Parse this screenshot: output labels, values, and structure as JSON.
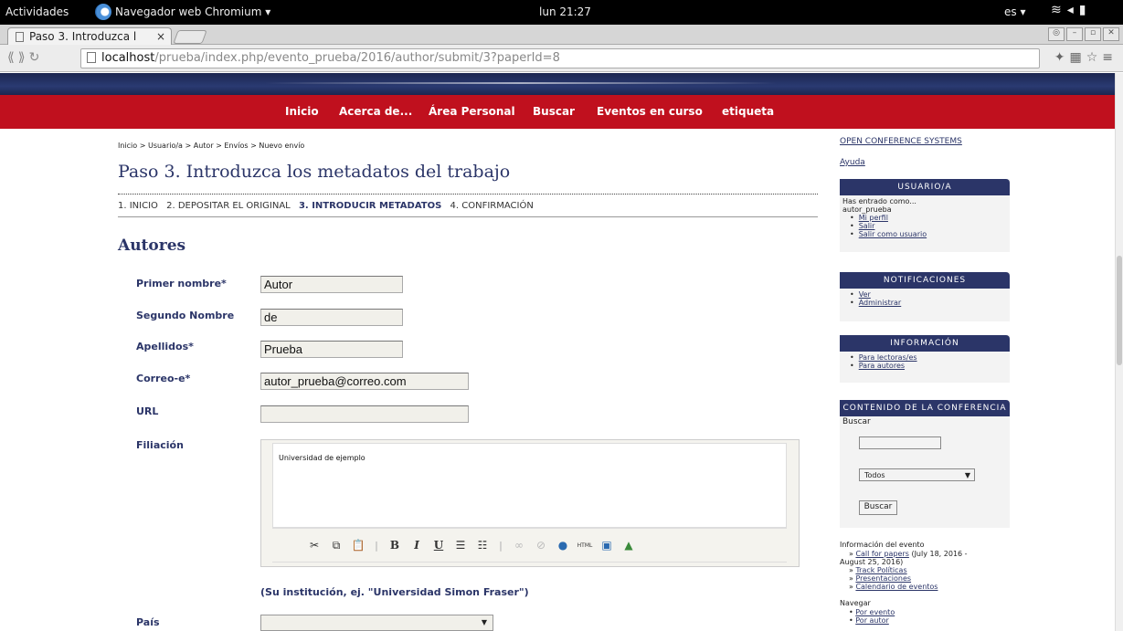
{
  "topbar": {
    "activities": "Actividades",
    "app_name": "Navegador web Chromium ▾",
    "clock": "lun 21:27",
    "lang": "es ▾",
    "sys_icons": "wifi-icon volume-icon battery-icon"
  },
  "tab": {
    "title": "Paso 3. Introduzca l",
    "close": "×"
  },
  "omnibox": {
    "host": "localhost",
    "path": "/prueba/index.php/evento_prueba/2016/author/submit/3?paperId=8"
  },
  "nav": [
    "Inicio",
    "Acerca de...",
    "Área Personal",
    "Buscar",
    "Eventos en curso",
    "etiqueta"
  ],
  "breadcrumb": "Inicio > Usuario/a > Autor > Envíos > Nuevo envío",
  "page_title": "Paso 3. Introduzca los metadatos del trabajo",
  "steps": [
    "1. INICIO",
    "2. DEPOSITAR EL ORIGINAL",
    "3. INTRODUCIR METADATOS",
    "4. CONFIRMACIÓN"
  ],
  "section_title": "Autores",
  "form": {
    "first_name_label": "Primer nombre*",
    "first_name_value": "Autor",
    "middle_name_label": "Segundo Nombre",
    "middle_name_value": "de",
    "last_name_label": "Apellidos*",
    "last_name_value": "Prueba",
    "email_label": "Correo-e*",
    "email_value": "autor_prueba@correo.com",
    "url_label": "URL",
    "url_value": "",
    "affiliation_label": "Filiación",
    "affiliation_value": "Universidad de ejemplo",
    "affiliation_hint": "(Su institución, ej. \"Universidad Simon Fraser\")",
    "country_label": "País",
    "country_value": ""
  },
  "sidebar": {
    "brand": "OPEN CONFERENCE SYSTEMS",
    "help": "Ayuda",
    "user_block": {
      "title": "USUARIO/A",
      "logged_as": "Has entrado como...",
      "username": "autor_prueba",
      "links": [
        "Mi perfil",
        "Salir",
        "Salir como usuario"
      ]
    },
    "notif_block": {
      "title": "NOTIFICACIONES",
      "links": [
        "Ver",
        "Administrar"
      ]
    },
    "info_block": {
      "title": "INFORMACIÓN",
      "links": [
        "Para lectoras/es",
        "Para autores"
      ]
    },
    "content_block": {
      "title": "CONTENIDO DE LA CONFERENCIA",
      "search_label": "Buscar",
      "search_scope": "Todos",
      "search_button": "Buscar"
    },
    "event_info_title": "Información del evento",
    "event_call": "Call for papers",
    "event_dates_1": "(July 18, 2016 -",
    "event_dates_2": "August 25, 2016)",
    "event_links": [
      "Track Políticas",
      "Presentaciones",
      "Calendario de eventos"
    ],
    "browse_title": "Navegar",
    "browse_links": [
      "Por evento",
      "Por autor"
    ]
  }
}
